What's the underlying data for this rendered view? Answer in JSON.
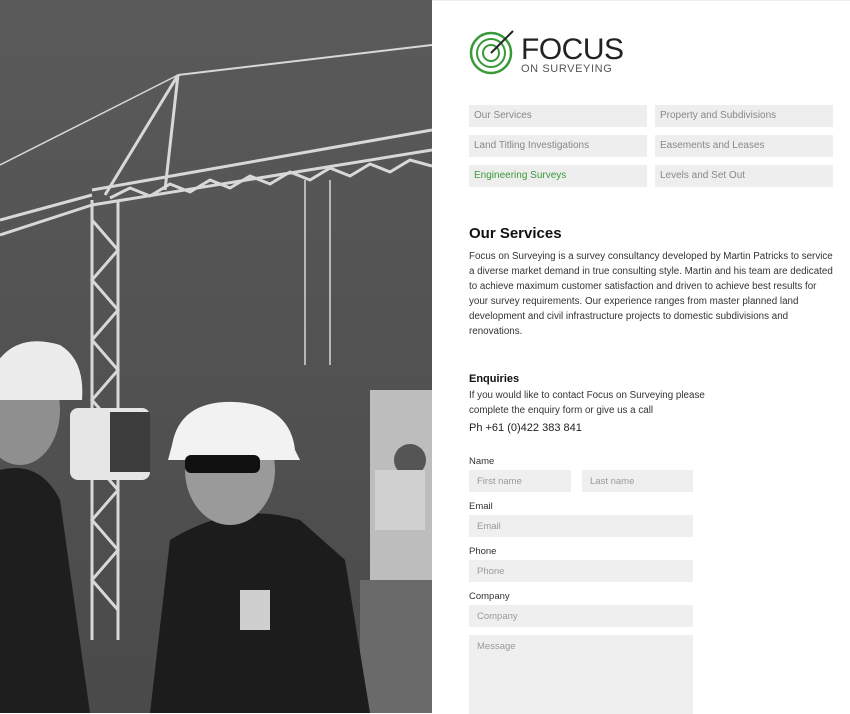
{
  "logo": {
    "word": "FOCUS",
    "tagline": "ON SURVEYING"
  },
  "nav": {
    "items": [
      {
        "label": "Our Services",
        "active": false
      },
      {
        "label": "Property and Subdivisions",
        "active": false
      },
      {
        "label": "Land Titling Investigations",
        "active": false
      },
      {
        "label": "Easements and Leases",
        "active": false
      },
      {
        "label": "Engineering Surveys",
        "active": true
      },
      {
        "label": "Levels and Set Out",
        "active": false
      }
    ]
  },
  "services": {
    "title": "Our Services",
    "body": "Focus on Surveying is a survey consultancy developed by Martin Patricks to service a diverse market demand in true consulting style. Martin and his team are dedicated to achieve maximum customer satisfaction and driven to achieve best results for your survey requirements. Our experience ranges from master planned land development and civil infrastructure projects to domestic subdivisions and renovations."
  },
  "enquiries": {
    "title": "Enquiries",
    "text": "If you would like to contact Focus on Surveying please complete the enquiry form or give us a call",
    "phone": "Ph +61 (0)422 383 841"
  },
  "form": {
    "name_label": "Name",
    "first_placeholder": "First name",
    "last_placeholder": "Last name",
    "email_label": "Email",
    "email_placeholder": "Email",
    "phone_label": "Phone",
    "phone_placeholder": "Phone",
    "company_label": "Company",
    "company_placeholder": "Company",
    "message_placeholder": "Message"
  },
  "colors": {
    "accent": "#3a9a3a",
    "field_bg": "#efefef",
    "nav_bg": "#eeeeee"
  }
}
